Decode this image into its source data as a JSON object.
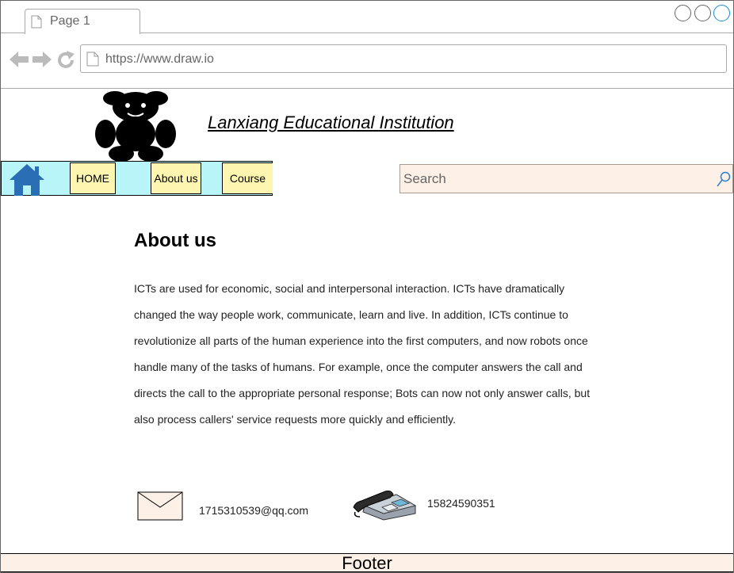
{
  "browser": {
    "tab_label": "Page 1",
    "url": "https://www.draw.io"
  },
  "site": {
    "title": "Lanxiang Educational Institution",
    "logo_icon": "teddy-bear-icon"
  },
  "nav": {
    "home_icon": "home-icon",
    "items": [
      {
        "label": "HOME"
      },
      {
        "label": "About us"
      },
      {
        "label": "Course"
      }
    ],
    "background": "#b7f5f8",
    "button_color": "#fdf5b0"
  },
  "search": {
    "placeholder": "Search",
    "background": "#fdf0e6"
  },
  "main": {
    "heading": "About us",
    "lines": [
      "ICTs are used for economic, social and interpersonal interaction. ICTs have dramatically",
      "changed the way people work, communicate, learn and live. In addition, ICTs continue to",
      "revolutionize all parts of the human experience into the first computers, and now robots once",
      "handle many of the tasks of humans. For example, once the computer answers the call and",
      "directs the call to the appropriate personal response; Bots can now not only answer calls, but",
      "also process callers' service requests more quickly and efficiently."
    ]
  },
  "contact": {
    "email": "1715310539@qq.com",
    "phone": "15824590351"
  },
  "footer": {
    "label": "Footer",
    "background": "#fdf0e6"
  }
}
